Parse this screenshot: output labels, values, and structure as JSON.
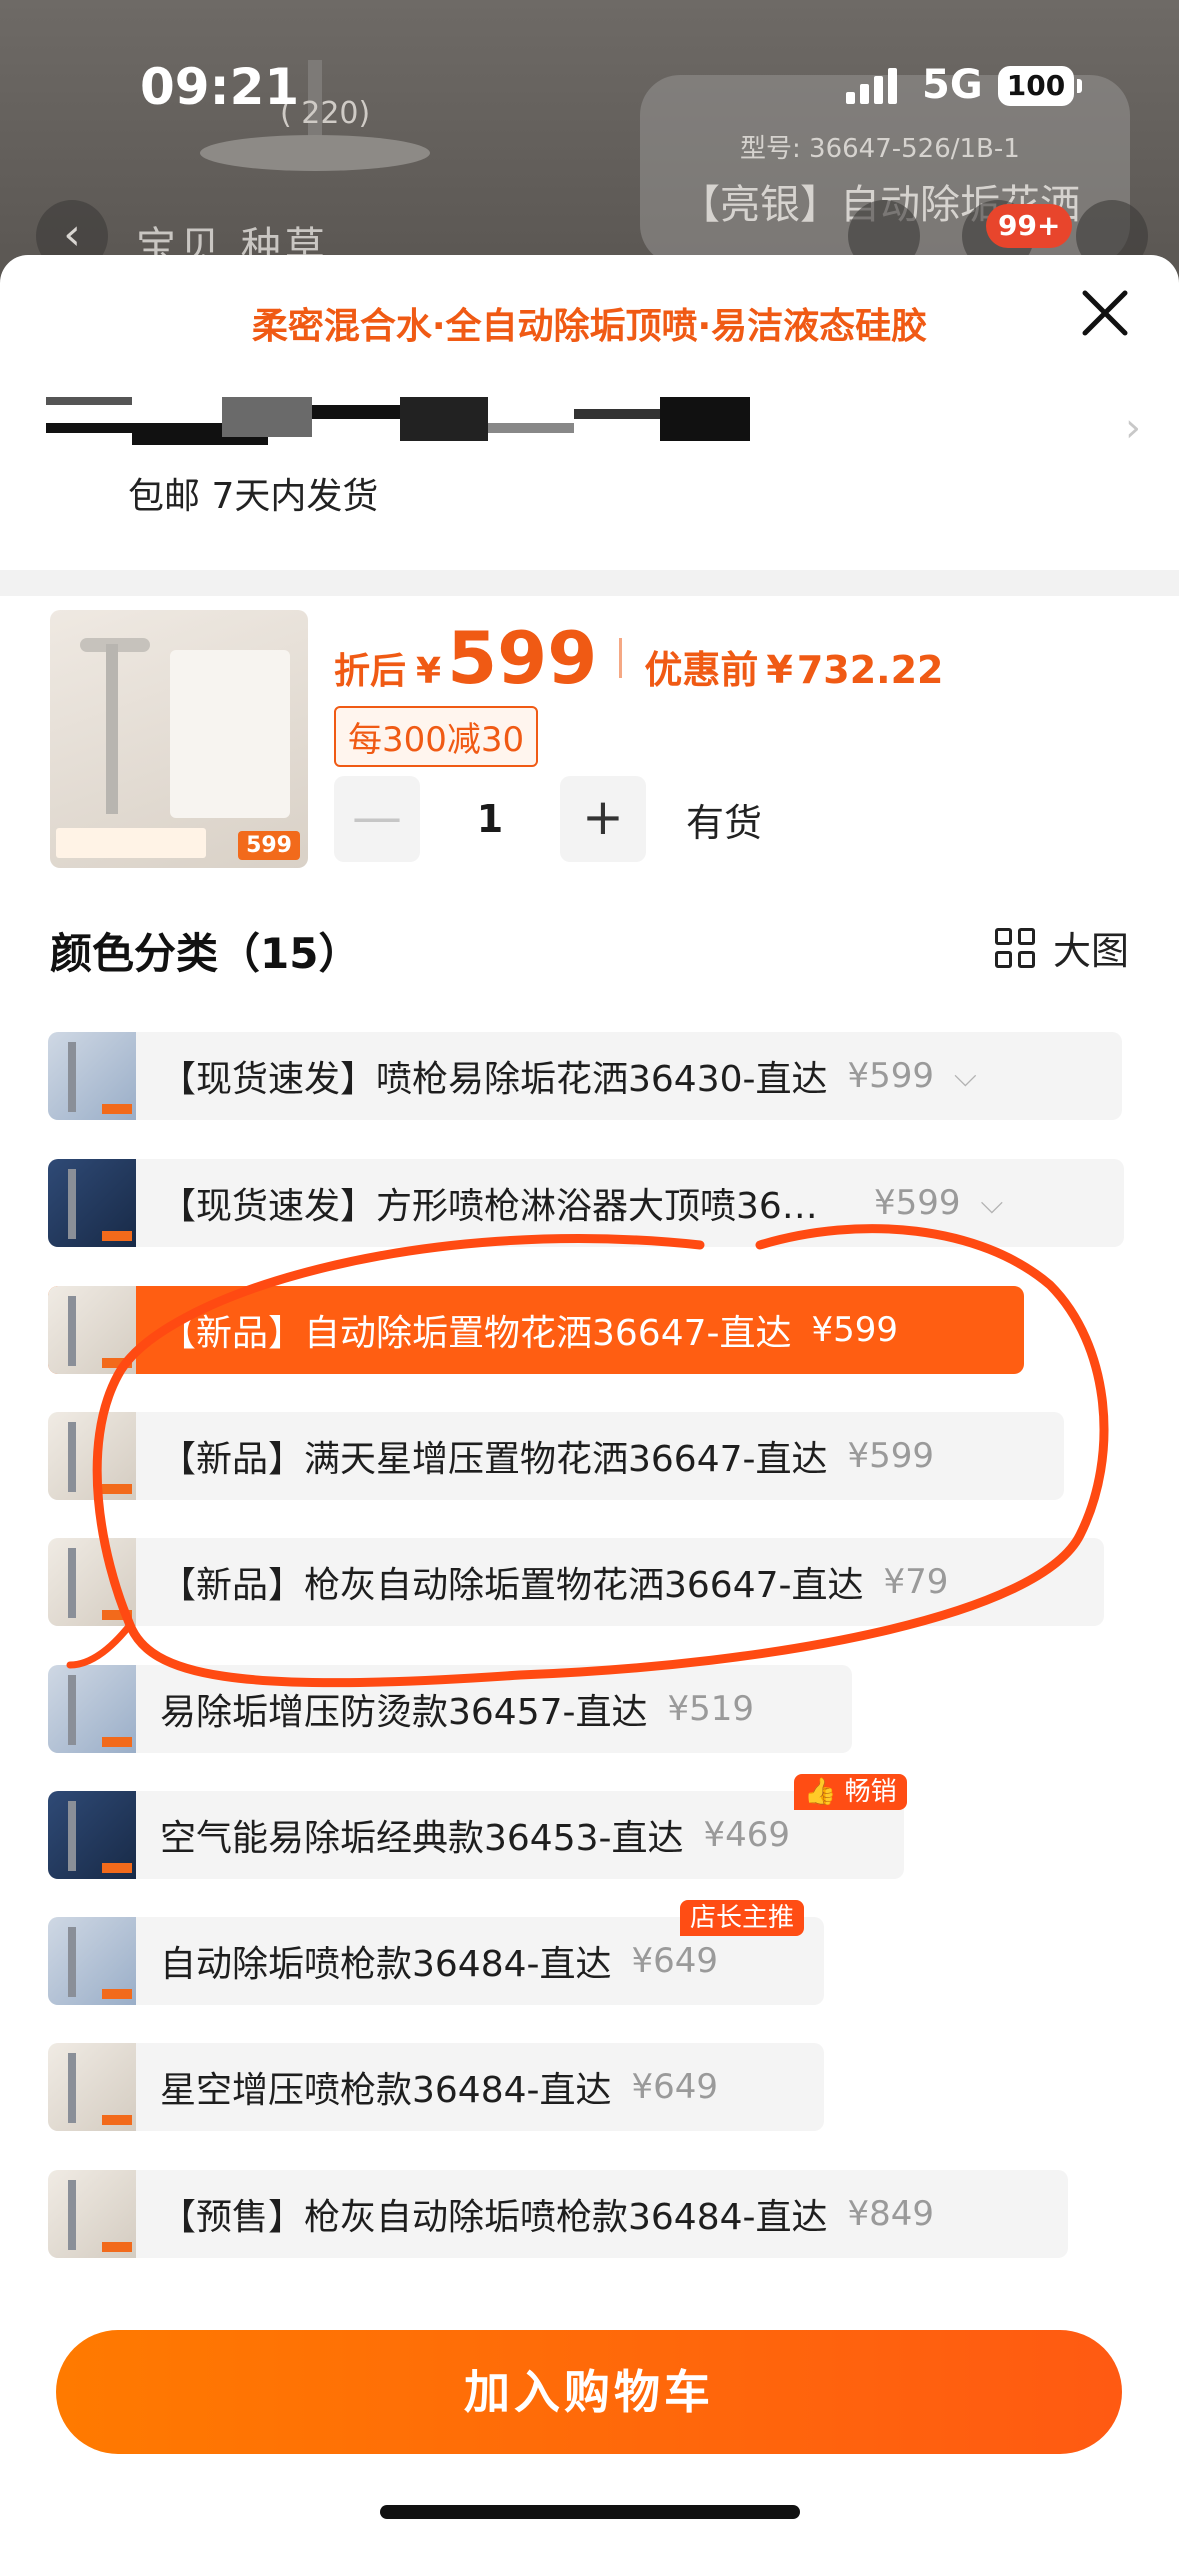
{
  "status_bar": {
    "time": "09:21",
    "network": "5G",
    "battery": "100"
  },
  "background_page": {
    "dimension_label": "( 220)",
    "model_label": "型号: 36647-526/1B-1",
    "product_title": "【亮银】自动除垢花洒",
    "tabs": "宝贝  种草",
    "cart_badge": "99+"
  },
  "sheet": {
    "promo_text": "柔密混合水·全自动除垢顶喷·易洁液态硅胶",
    "shipping_text": "包邮 7天内发货"
  },
  "product": {
    "thumb_price_tag": "599",
    "price_label": "折后",
    "currency": "¥",
    "price": "599",
    "original_label": "优惠前",
    "original_price": "732.22",
    "coupon": "每300减30",
    "quantity": "1",
    "minus": "—",
    "plus": "+",
    "stock": "有货"
  },
  "category": {
    "title": "颜色分类（15）",
    "big_image_label": "大图"
  },
  "options": [
    {
      "label": "【现货速发】喷枪易除垢花洒36430-直达",
      "price": "¥599",
      "chevron": "⌵"
    },
    {
      "label": "【现货速发】方形喷枪淋浴器大顶喷36…",
      "price": "¥599",
      "chevron": "⌵"
    },
    {
      "label": "【新品】自动除垢置物花洒36647-直达",
      "price": "¥599"
    },
    {
      "label": "【新品】满天星增压置物花洒36647-直达",
      "price": "¥599"
    },
    {
      "label": "【新品】枪灰自动除垢置物花洒36647-直达",
      "price": "¥79"
    },
    {
      "label": "易除垢增压防烫款36457-直达",
      "price": "¥519"
    },
    {
      "label": "空气能易除垢经典款36453-直达",
      "price": "¥469",
      "flag": "👍 畅销"
    },
    {
      "label": "自动除垢喷枪款36484-直达",
      "price": "¥649",
      "flag": "店长主推"
    },
    {
      "label": "星空增压喷枪款36484-直达",
      "price": "¥649"
    },
    {
      "label": "【预售】枪灰自动除垢喷枪款36484-直达",
      "price": "¥849"
    }
  ],
  "add_to_cart": "加入购物车",
  "colors": {
    "accent": "#ff5e12",
    "annotation": "#ff4a12"
  }
}
